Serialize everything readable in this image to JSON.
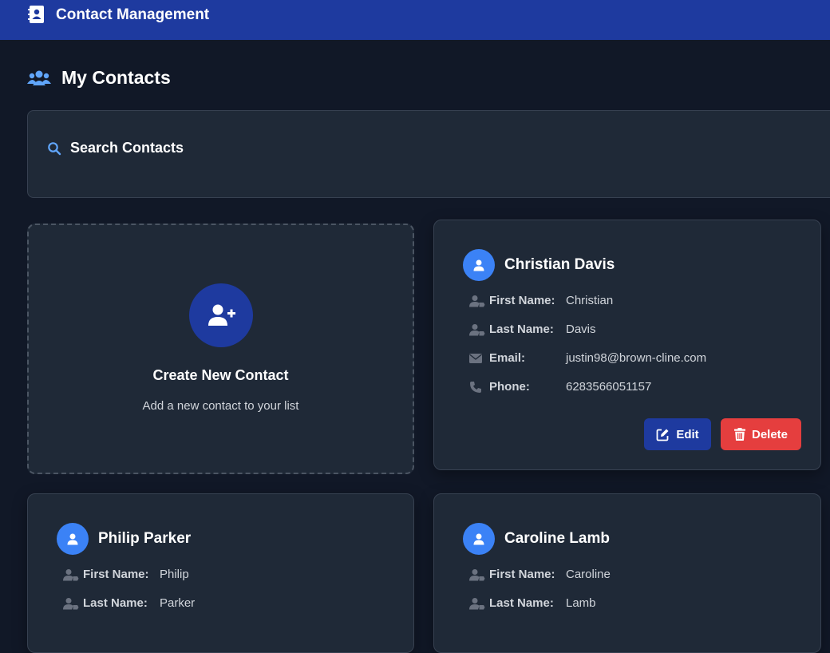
{
  "app": {
    "title": "Contact Management",
    "brand_icon": "address-book-icon",
    "accent_color": "#1e3a9f"
  },
  "page": {
    "heading": "My Contacts",
    "heading_icon": "users-icon"
  },
  "search": {
    "title": "Search Contacts",
    "icon": "search-icon"
  },
  "create": {
    "title": "Create New Contact",
    "subtitle": "Add a new contact to your list",
    "icon": "user-plus-icon"
  },
  "labels": {
    "first_name": "First Name:",
    "last_name": "Last Name:",
    "email": "Email:",
    "phone": "Phone:",
    "edit": "Edit",
    "delete": "Delete"
  },
  "contacts": [
    {
      "name": "Christian Davis",
      "first_name": "Christian",
      "last_name": "Davis",
      "email": "justin98@brown-cline.com",
      "phone": "6283566051157"
    },
    {
      "name": "Philip Parker",
      "first_name": "Philip",
      "last_name": "Parker"
    },
    {
      "name": "Caroline Lamb",
      "first_name": "Caroline",
      "last_name": "Lamb"
    }
  ],
  "colors": {
    "background": "#111827",
    "card": "#1f2937",
    "avatar": "#3b82f6",
    "delete": "#e53e3e"
  }
}
